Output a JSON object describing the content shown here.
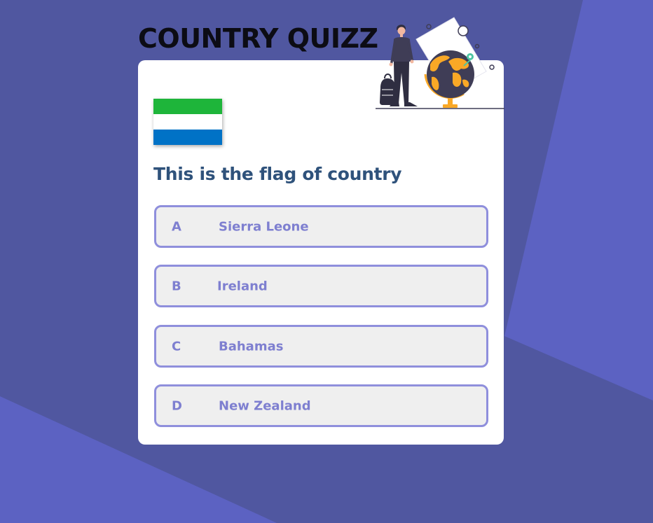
{
  "page": {
    "title": "COUNTRY QUIZZ"
  },
  "quiz": {
    "question": "This is the flag of country",
    "flag": {
      "country_shown": "Sierra Leone",
      "stripe_colors": [
        "#1eb53a",
        "#ffffff",
        "#0072c6"
      ]
    },
    "options": [
      {
        "letter": "A",
        "answer": "Sierra Leone"
      },
      {
        "letter": "B",
        "answer": "Ireland"
      },
      {
        "letter": "C",
        "answer": "Bahamas"
      },
      {
        "letter": "D",
        "answer": "New Zealand"
      }
    ]
  },
  "theme": {
    "background": "#5057a0",
    "background_accent": "#5c62c2",
    "card": "#ffffff",
    "title_color": "#0c0c14",
    "question_color": "#2f527b",
    "option_border": "#8f8fdc",
    "option_bg": "#efefef",
    "option_text": "#7e7fd0",
    "globe_continents": "#f9a826",
    "globe_ocean": "#3f3d56"
  },
  "icons": {
    "illustration": "traveler-with-globe-illustration",
    "flag": "sierra-leone-flag-icon"
  }
}
